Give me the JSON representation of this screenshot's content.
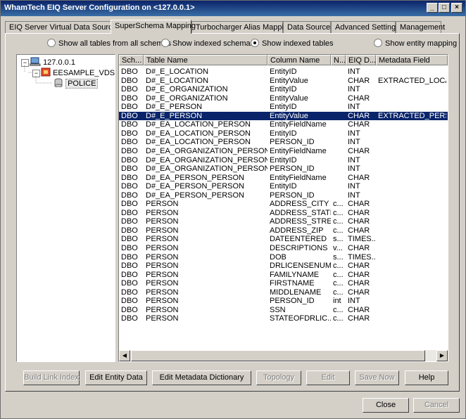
{
  "window": {
    "title": "WhamTech EIQ Server Configuration on <127.0.0.1>"
  },
  "tabs": [
    {
      "label": "EIQ Server Virtual Data Sources"
    },
    {
      "label": "SuperSchema Mapping"
    },
    {
      "label": "Turbocharger Alias Mapping"
    },
    {
      "label": "Data Sources"
    },
    {
      "label": "Advanced Settings"
    },
    {
      "label": "Management"
    }
  ],
  "active_tab": "SuperSchema Mapping",
  "radios": [
    {
      "label": "Show all tables from all schemas",
      "selected": false
    },
    {
      "label": "Show indexed schemas",
      "selected": false
    },
    {
      "label": "Show indexed tables",
      "selected": true
    },
    {
      "label": "Show entity mapping",
      "selected": false
    }
  ],
  "tree": {
    "root": "127.0.0.1",
    "child": "EESAMPLE_VDS",
    "leaf": "POLICE"
  },
  "grid": {
    "columns": [
      "Sch...",
      "Table Name",
      "Column Name",
      "N...",
      "EIQ D...",
      "Metadata Field"
    ],
    "selected_row": 5,
    "rows": [
      [
        "DBO",
        "D#_E_LOCATION",
        "EntityID",
        "",
        "INT",
        ""
      ],
      [
        "DBO",
        "D#_E_LOCATION",
        "EntityValue",
        "",
        "CHAR",
        "EXTRACTED_LOCA..."
      ],
      [
        "DBO",
        "D#_E_ORGANIZATION",
        "EntityID",
        "",
        "INT",
        ""
      ],
      [
        "DBO",
        "D#_E_ORGANIZATION",
        "EntityValue",
        "",
        "CHAR",
        ""
      ],
      [
        "DBO",
        "D#_E_PERSON",
        "EntityID",
        "",
        "INT",
        ""
      ],
      [
        "DBO",
        "D#_E_PERSON",
        "EntityValue",
        "",
        "CHAR",
        "EXTRACTED_PERS..."
      ],
      [
        "DBO",
        "D#_EA_LOCATION_PERSON",
        "EntityFieldName",
        "",
        "CHAR",
        ""
      ],
      [
        "DBO",
        "D#_EA_LOCATION_PERSON",
        "EntityID",
        "",
        "INT",
        ""
      ],
      [
        "DBO",
        "D#_EA_LOCATION_PERSON",
        "PERSON_ID",
        "",
        "INT",
        ""
      ],
      [
        "DBO",
        "D#_EA_ORGANIZATION_PERSON",
        "EntityFieldName",
        "",
        "CHAR",
        ""
      ],
      [
        "DBO",
        "D#_EA_ORGANIZATION_PERSON",
        "EntityID",
        "",
        "INT",
        ""
      ],
      [
        "DBO",
        "D#_EA_ORGANIZATION_PERSON",
        "PERSON_ID",
        "",
        "INT",
        ""
      ],
      [
        "DBO",
        "D#_EA_PERSON_PERSON",
        "EntityFieldName",
        "",
        "CHAR",
        ""
      ],
      [
        "DBO",
        "D#_EA_PERSON_PERSON",
        "EntityID",
        "",
        "INT",
        ""
      ],
      [
        "DBO",
        "D#_EA_PERSON_PERSON",
        "PERSON_ID",
        "",
        "INT",
        ""
      ],
      [
        "DBO",
        "PERSON",
        "ADDRESS_CITY",
        "c...",
        "CHAR",
        ""
      ],
      [
        "DBO",
        "PERSON",
        "ADDRESS_STATE",
        "c...",
        "CHAR",
        ""
      ],
      [
        "DBO",
        "PERSON",
        "ADDRESS_STRE...",
        "c...",
        "CHAR",
        ""
      ],
      [
        "DBO",
        "PERSON",
        "ADDRESS_ZIP",
        "c...",
        "CHAR",
        ""
      ],
      [
        "DBO",
        "PERSON",
        "DATEENTERED",
        "s...",
        "TIMES...",
        ""
      ],
      [
        "DBO",
        "PERSON",
        "DESCRIPTIONS",
        "v...",
        "CHAR",
        ""
      ],
      [
        "DBO",
        "PERSON",
        "DOB",
        "s...",
        "TIMES...",
        ""
      ],
      [
        "DBO",
        "PERSON",
        "DRLICENSENUM",
        "c...",
        "CHAR",
        ""
      ],
      [
        "DBO",
        "PERSON",
        "FAMILYNAME",
        "c...",
        "CHAR",
        ""
      ],
      [
        "DBO",
        "PERSON",
        "FIRSTNAME",
        "c...",
        "CHAR",
        ""
      ],
      [
        "DBO",
        "PERSON",
        "MIDDLENAME",
        "c...",
        "CHAR",
        ""
      ],
      [
        "DBO",
        "PERSON",
        "PERSON_ID",
        "int",
        "INT",
        ""
      ],
      [
        "DBO",
        "PERSON",
        "SSN",
        "c...",
        "CHAR",
        ""
      ],
      [
        "DBO",
        "PERSON",
        "STATEOFDRLIC...",
        "c...",
        "CHAR",
        ""
      ]
    ]
  },
  "buttons": {
    "build_link_index": "Build Link Index",
    "edit_entity_data": "Edit Entity Data",
    "edit_metadata_dictionary": "Edit Metadata Dictionary",
    "topology": "Topology",
    "edit": "Edit",
    "save_now": "Save Now",
    "help": "Help",
    "close": "Close",
    "cancel": "Cancel"
  }
}
